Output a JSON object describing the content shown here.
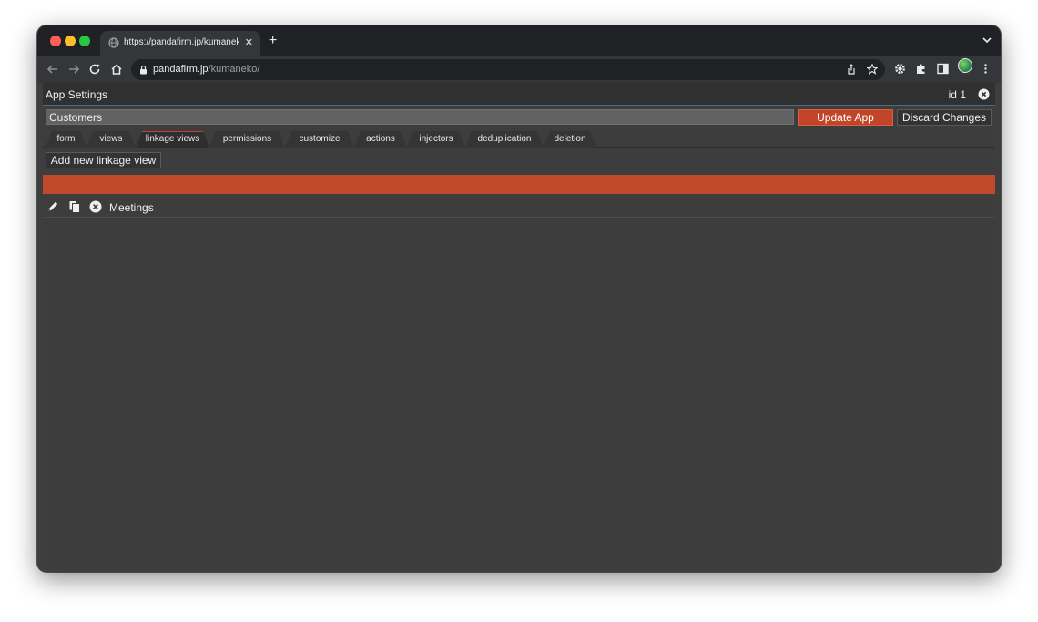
{
  "browser": {
    "tab_title": "https://pandafirm.jp/kumaneko/",
    "url_host": "pandafirm.jp",
    "url_path": "/kumaneko/"
  },
  "panel": {
    "title": "App Settings",
    "id_label": "id 1",
    "app_name_value": "Customers",
    "update_label": "Update App",
    "discard_label": "Discard Changes"
  },
  "tabs": [
    {
      "label": "form"
    },
    {
      "label": "views"
    },
    {
      "label": "linkage views"
    },
    {
      "label": "permissions"
    },
    {
      "label": "customize"
    },
    {
      "label": "actions"
    },
    {
      "label": "injectors"
    },
    {
      "label": "deduplication"
    },
    {
      "label": "deletion"
    }
  ],
  "active_tab": "linkage views",
  "add_button_label": "Add new linkage view",
  "linkage_views": [
    {
      "name": "Meetings"
    }
  ],
  "colors": {
    "accent": "#c2452a",
    "background": "#3d3d3d"
  }
}
